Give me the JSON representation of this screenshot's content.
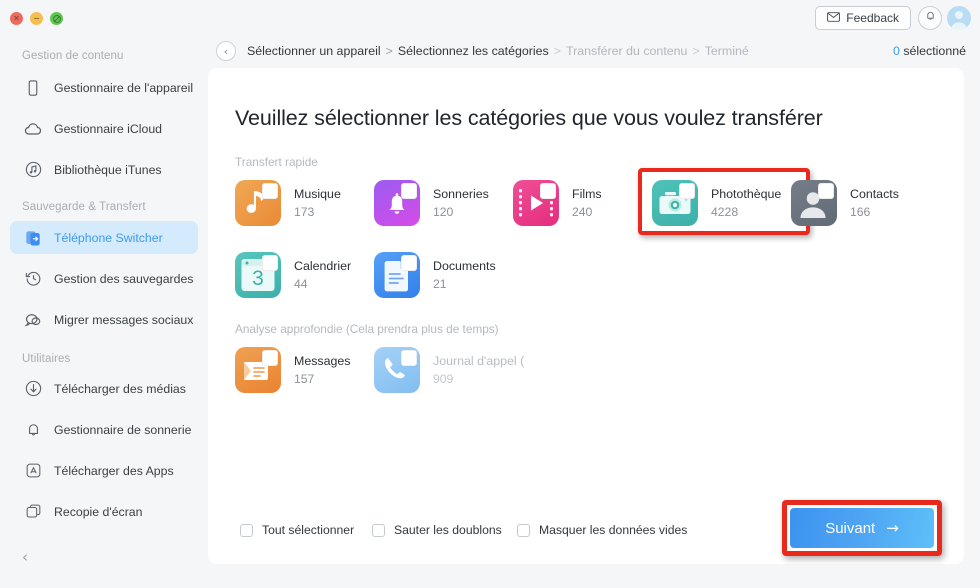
{
  "window": {
    "traffic_lights": [
      "close",
      "minimize",
      "maximize"
    ]
  },
  "topbar": {
    "feedback_label": "Feedback",
    "feedback_icon": "envelope-icon",
    "bell_icon": "bell-icon",
    "avatar_icon": "user-avatar-icon",
    "back_icon": "chevron-left-icon"
  },
  "breadcrumb": {
    "items": [
      {
        "label": "Sélectionner un appareil",
        "state": "done"
      },
      {
        "label": "Sélectionnez les catégories",
        "state": "current"
      },
      {
        "label": "Transférer du contenu",
        "state": "upcoming"
      },
      {
        "label": "Terminé",
        "state": "upcoming"
      }
    ],
    "separator": ">"
  },
  "selection_status": {
    "count": "0",
    "label": "sélectionné"
  },
  "sidebar": {
    "groups": [
      {
        "title": "Gestion de contenu",
        "items": [
          {
            "label": "Gestionnaire de l'appareil",
            "icon": "phone-icon",
            "active": false
          },
          {
            "label": "Gestionnaire iCloud",
            "icon": "cloud-icon",
            "active": false
          },
          {
            "label": "Bibliothèque iTunes",
            "icon": "itunes-music-icon",
            "active": false
          }
        ]
      },
      {
        "title": "Sauvegarde & Transfert",
        "items": [
          {
            "label": "Téléphone Switcher",
            "icon": "phone-switch-icon",
            "active": true
          },
          {
            "label": "Gestion des sauvegardes",
            "icon": "clock-restore-icon",
            "active": false
          },
          {
            "label": "Migrer messages sociaux",
            "icon": "chat-bubbles-icon",
            "active": false
          }
        ]
      },
      {
        "title": "Utilitaires",
        "items": [
          {
            "label": "Télécharger des médias",
            "icon": "download-circle-icon",
            "active": false
          },
          {
            "label": "Gestionnaire de sonnerie",
            "icon": "bell-outline-icon",
            "active": false
          },
          {
            "label": "Télécharger des Apps",
            "icon": "appstore-icon",
            "active": false
          },
          {
            "label": "Recopie d'écran",
            "icon": "screen-mirror-icon",
            "active": false
          }
        ]
      }
    ],
    "collapse_icon": "chevron-left-icon"
  },
  "main": {
    "title": "Veuillez sélectionner les catégories que vous voulez transférer",
    "sections": [
      {
        "label": "Transfert rapide",
        "tiles": [
          {
            "name": "Musique",
            "count": "173",
            "icon": "music-note-icon",
            "color": "#ef9342",
            "dimmed": false,
            "highlighted": false
          },
          {
            "name": "Sonneries",
            "count": "120",
            "icon": "bell-icon",
            "color": "#b84df0",
            "dimmed": false,
            "highlighted": false
          },
          {
            "name": "Films",
            "count": "240",
            "icon": "film-play-icon",
            "color": "#e8418a",
            "dimmed": false,
            "highlighted": false
          },
          {
            "name": "Photothèque",
            "count": "4228",
            "icon": "camera-icon",
            "color": "#45b8b2",
            "dimmed": false,
            "highlighted": true
          },
          {
            "name": "Contacts",
            "count": "166",
            "icon": "contact-card-icon",
            "color": "#6b7480",
            "dimmed": false,
            "highlighted": false
          },
          {
            "name": "Calendrier",
            "count": "44",
            "icon": "calendar-3-icon",
            "color": "#45b8b2",
            "dimmed": false,
            "highlighted": false
          },
          {
            "name": "Documents",
            "count": "21",
            "icon": "document-icon",
            "color": "#3d8ef0",
            "dimmed": false,
            "highlighted": false
          }
        ]
      },
      {
        "label": "Analyse approfondie (Cela prendra plus de temps)",
        "tiles": [
          {
            "name": "Messages",
            "count": "157",
            "icon": "message-envelope-icon",
            "color": "#ef9342",
            "dimmed": false,
            "highlighted": false
          },
          {
            "name": "Journal d'appel (",
            "count": "909",
            "icon": "phone-call-icon",
            "color": "#8dc4f2",
            "dimmed": true,
            "highlighted": false
          }
        ]
      }
    ],
    "options": [
      {
        "label": "Tout sélectionner",
        "checked": false
      },
      {
        "label": "Sauter les doublons",
        "checked": false
      },
      {
        "label": "Masquer les données vides",
        "checked": false
      }
    ],
    "next_button": {
      "label": "Suivant",
      "icon": "arrow-right-icon"
    }
  },
  "colors": {
    "accent": "#3d9bf0",
    "highlight": "#e8291c",
    "sidebar_bg": "#f5f6f7",
    "card_bg": "#ffffff",
    "active_item_bg": "#d4eafd"
  }
}
